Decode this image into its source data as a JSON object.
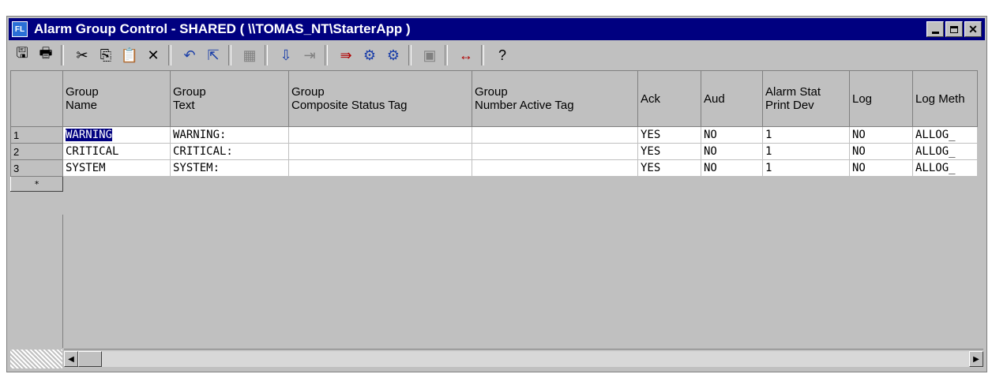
{
  "window": {
    "title": "Alarm Group Control - SHARED  ( \\\\TOMAS_NT\\StarterApp )",
    "app_icon_text": "FL"
  },
  "toolbar": {
    "buttons": [
      {
        "name": "save-icon",
        "glyph": "🖫"
      },
      {
        "name": "print-icon",
        "glyph": "🖶"
      },
      {
        "name": "cut-icon",
        "glyph": "✂"
      },
      {
        "name": "copy-icon",
        "glyph": "⎘"
      },
      {
        "name": "paste-icon",
        "glyph": "📋"
      },
      {
        "name": "delete-icon",
        "glyph": "✕"
      },
      {
        "name": "undo-icon",
        "glyph": "↶"
      },
      {
        "name": "import-icon",
        "glyph": "⇱"
      },
      {
        "name": "grid-icon",
        "glyph": "▦"
      },
      {
        "name": "insert-row-icon",
        "glyph": "⇩"
      },
      {
        "name": "insert-col-icon",
        "glyph": "⇥"
      },
      {
        "name": "tag-browse-icon",
        "glyph": "⇛"
      },
      {
        "name": "find-icon",
        "glyph": "⚙"
      },
      {
        "name": "find-next-icon",
        "glyph": "⚙"
      },
      {
        "name": "properties-icon",
        "glyph": "▣"
      },
      {
        "name": "column-width-icon",
        "glyph": "↔"
      },
      {
        "name": "help-icon",
        "glyph": "?"
      }
    ]
  },
  "table": {
    "columns": [
      {
        "line1": "Group",
        "line2": "Name"
      },
      {
        "line1": "Group",
        "line2": "Text"
      },
      {
        "line1": "Group",
        "line2": "Composite Status Tag"
      },
      {
        "line1": "Group",
        "line2": "Number Active Tag"
      },
      {
        "line1": "Ack",
        "line2": ""
      },
      {
        "line1": "Aud",
        "line2": ""
      },
      {
        "line1": "Alarm Stat",
        "line2": "Print Dev"
      },
      {
        "line1": "Log",
        "line2": ""
      },
      {
        "line1": "Log Meth",
        "line2": ""
      }
    ],
    "rows": [
      {
        "num": "1",
        "cells": [
          "WARNING",
          "WARNING:",
          "",
          "",
          "YES",
          "NO",
          "1",
          "NO",
          "ALLOG_"
        ]
      },
      {
        "num": "2",
        "cells": [
          "CRITICAL",
          "CRITICAL:",
          "",
          "",
          "YES",
          "NO",
          "1",
          "NO",
          "ALLOG_"
        ]
      },
      {
        "num": "3",
        "cells": [
          "SYSTEM",
          "SYSTEM:",
          "",
          "",
          "YES",
          "NO",
          "1",
          "NO",
          "ALLOG_"
        ]
      }
    ],
    "new_row_marker": "*"
  },
  "scrollbar": {
    "left_arrow": "◀",
    "right_arrow": "▶"
  }
}
